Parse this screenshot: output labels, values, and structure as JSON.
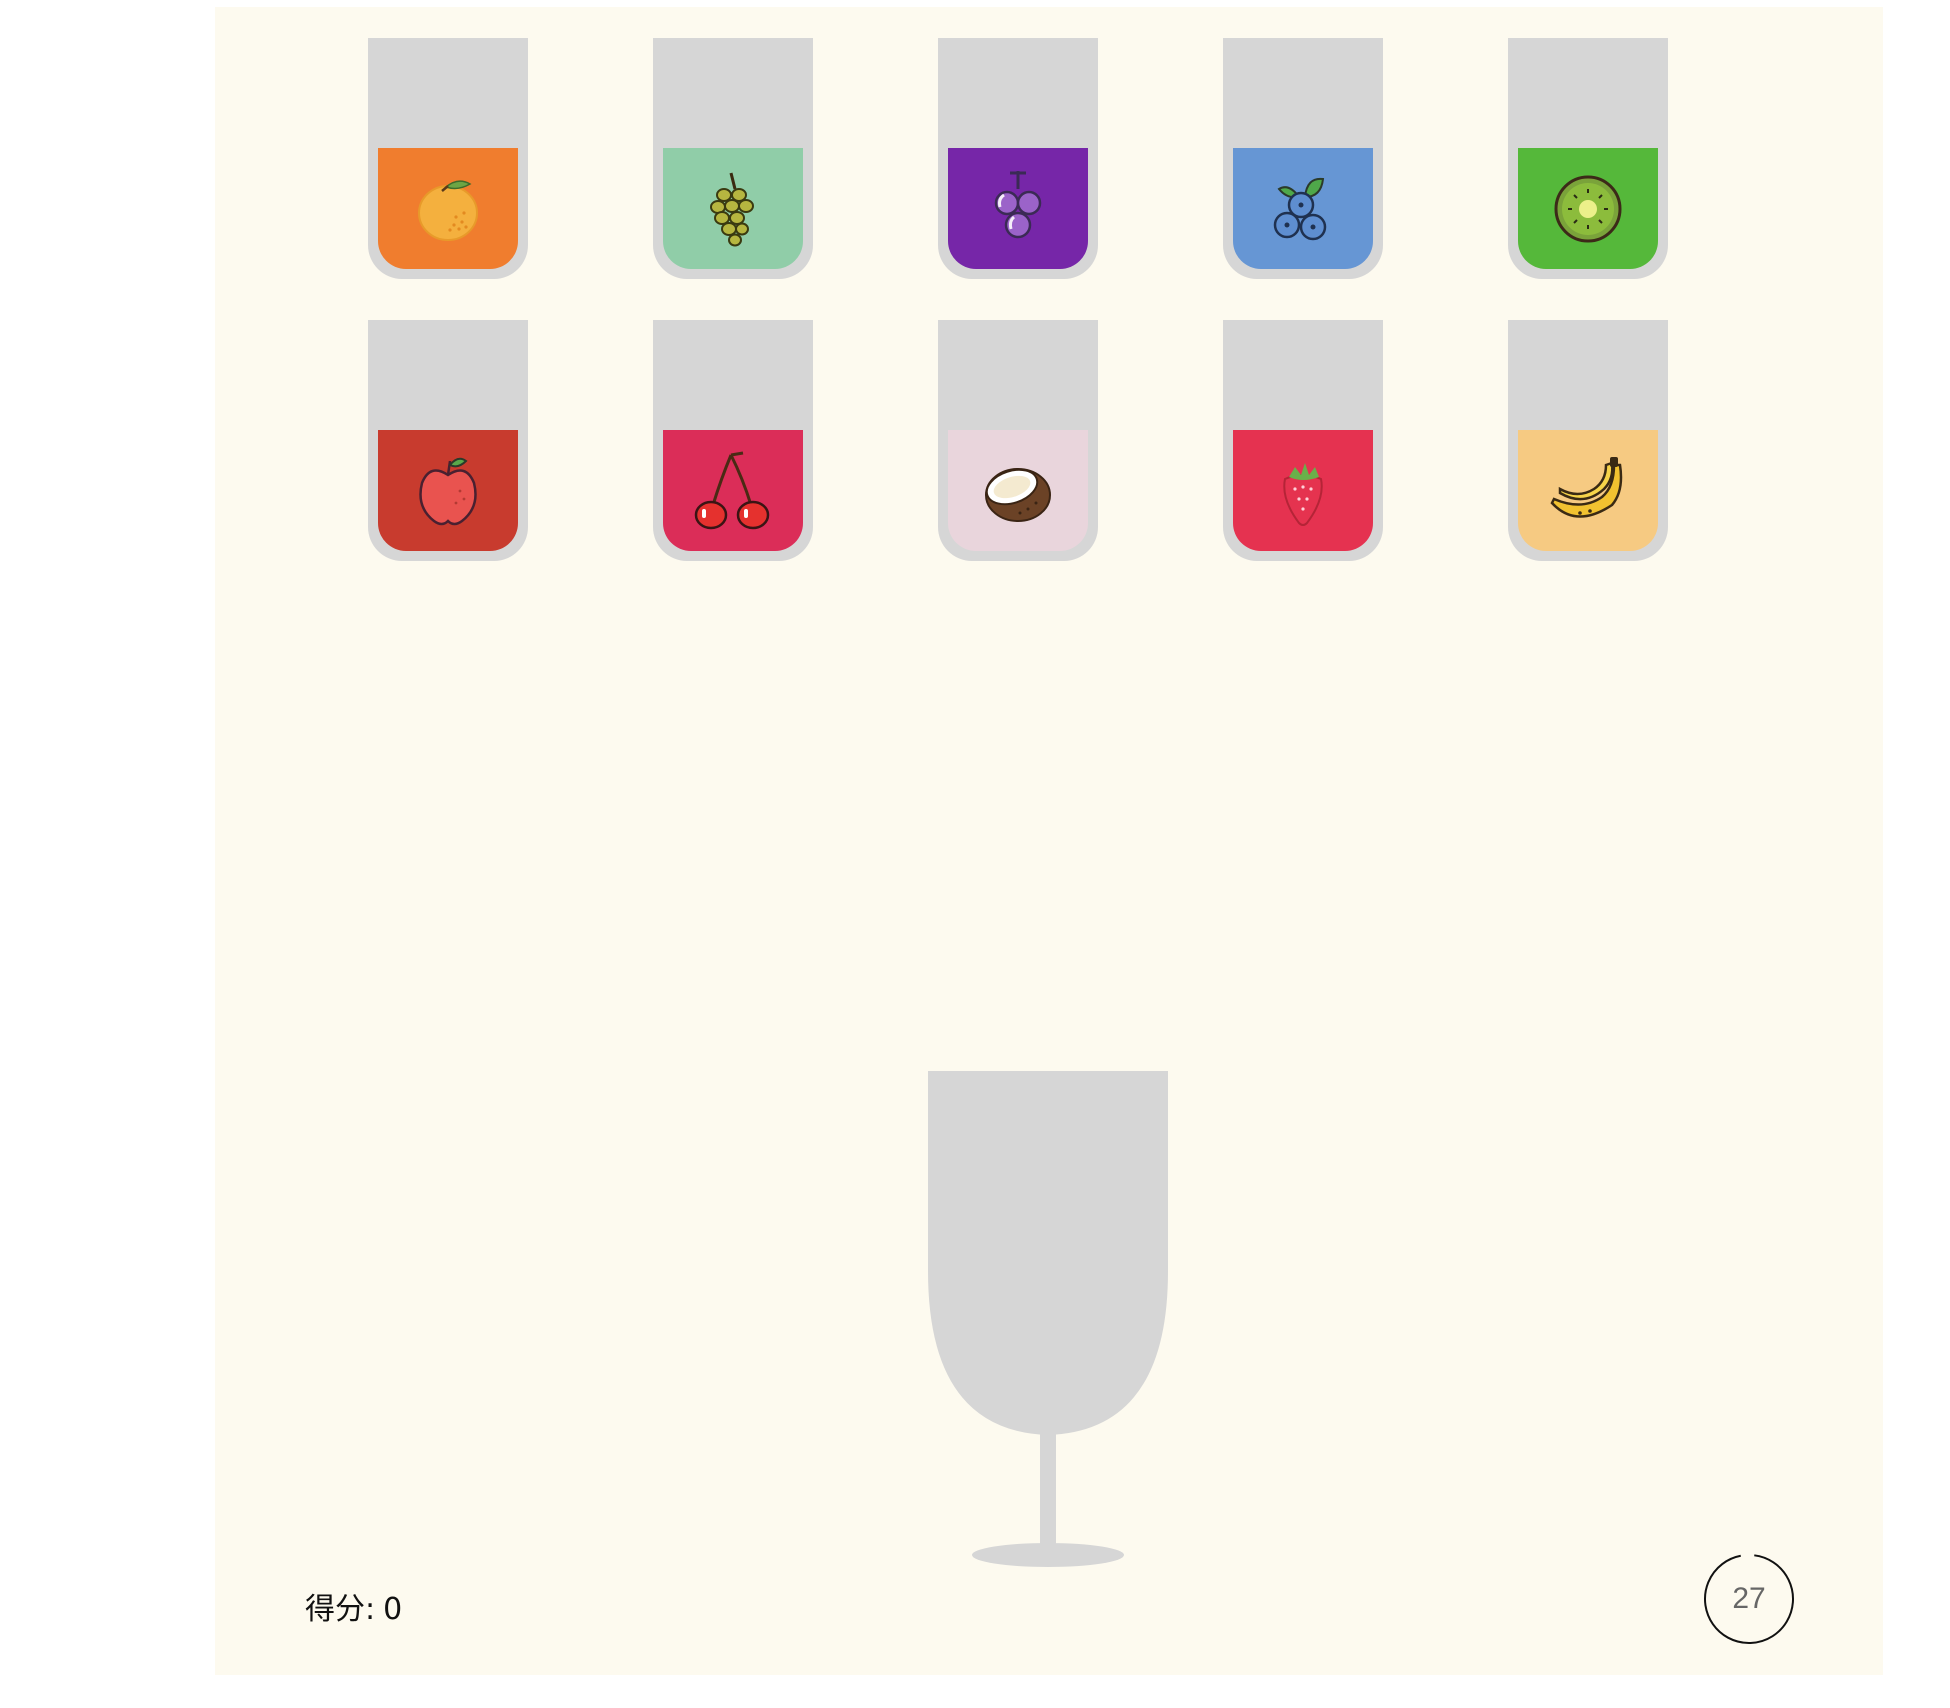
{
  "score": {
    "label": "得分:",
    "value": "0"
  },
  "timer": {
    "value": "27",
    "progress": 0.97
  },
  "cups": [
    {
      "fruit": "orange",
      "color": "#f07d2e"
    },
    {
      "fruit": "green-grapes",
      "color": "#90cda8"
    },
    {
      "fruit": "purple-grapes",
      "color": "#7626a8"
    },
    {
      "fruit": "blueberry",
      "color": "#6696d4"
    },
    {
      "fruit": "kiwi",
      "color": "#55b83a"
    },
    {
      "fruit": "apple",
      "color": "#c83b2e"
    },
    {
      "fruit": "cherry",
      "color": "#db2d58"
    },
    {
      "fruit": "coconut",
      "color": "#e9d5dc"
    },
    {
      "fruit": "strawberry",
      "color": "#e53250"
    },
    {
      "fruit": "banana",
      "color": "#f6ca82"
    }
  ],
  "glass": {
    "color": "#d6d6d6"
  }
}
